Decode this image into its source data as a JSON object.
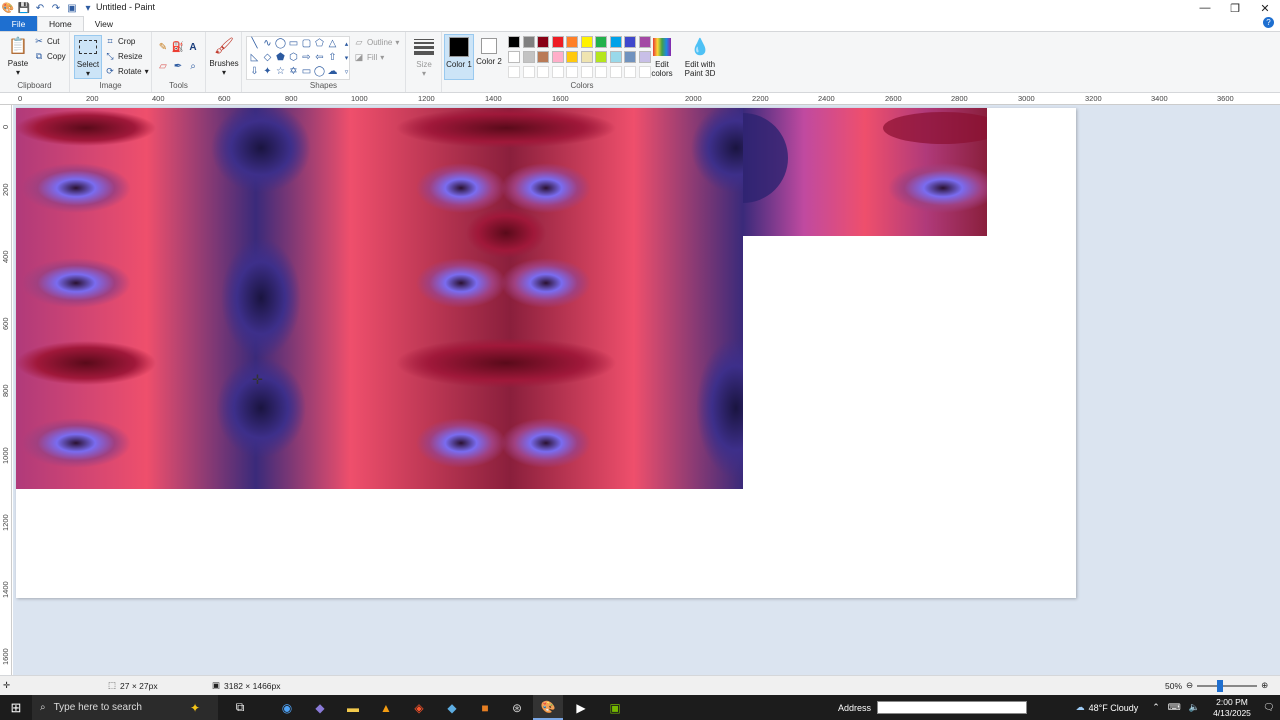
{
  "window": {
    "title": "Untitled - Paint"
  },
  "tabs": [
    "File",
    "Home",
    "View"
  ],
  "ribbon": {
    "clipboard": {
      "label": "Clipboard",
      "paste": "Paste",
      "cut": "Cut",
      "copy": "Copy"
    },
    "image": {
      "label": "Image",
      "select": "Select",
      "crop": "Crop",
      "resize": "Resize",
      "rotate": "Rotate"
    },
    "tools": {
      "label": "Tools"
    },
    "brushes": "Brushes",
    "shapes": {
      "label": "Shapes",
      "outline": "Outline",
      "fill": "Fill"
    },
    "size": "Size",
    "colors": {
      "label": "Colors",
      "color1": "Color 1",
      "color2": "Color 2",
      "edit_colors": "Edit colors",
      "edit_paint3d": "Edit with Paint 3D",
      "color1_value": "#000000",
      "color2_value": "#ffffff",
      "palette_row1": [
        "#000000",
        "#7f7f7f",
        "#880015",
        "#ed1c24",
        "#ff7f27",
        "#fff200",
        "#22b14c",
        "#00a2e8",
        "#3f48cc",
        "#a349a4"
      ],
      "palette_row2": [
        "#ffffff",
        "#c3c3c3",
        "#b97a57",
        "#ffaec9",
        "#ffc90e",
        "#efe4b0",
        "#b5e61d",
        "#99d9ea",
        "#7092be",
        "#c8bfe7"
      ]
    }
  },
  "ruler": {
    "top": [
      "0",
      "200",
      "400",
      "600",
      "800",
      "1000",
      "1200",
      "1400",
      "1600",
      "2000",
      "2200",
      "2400",
      "2600",
      "2800",
      "3000",
      "3200",
      "3400",
      "3600"
    ],
    "left": [
      "0",
      "200",
      "400",
      "600",
      "800",
      "1000",
      "1200",
      "1400",
      "1600"
    ]
  },
  "status": {
    "selection_size": "27 × 27px",
    "image_size": "3182 × 1466px",
    "zoom": "50%"
  },
  "taskbar": {
    "search_placeholder": "Type here to search",
    "address_label": "Address",
    "weather": "48°F  Cloudy",
    "time": "2:00 PM",
    "date": "4/13/2025"
  }
}
